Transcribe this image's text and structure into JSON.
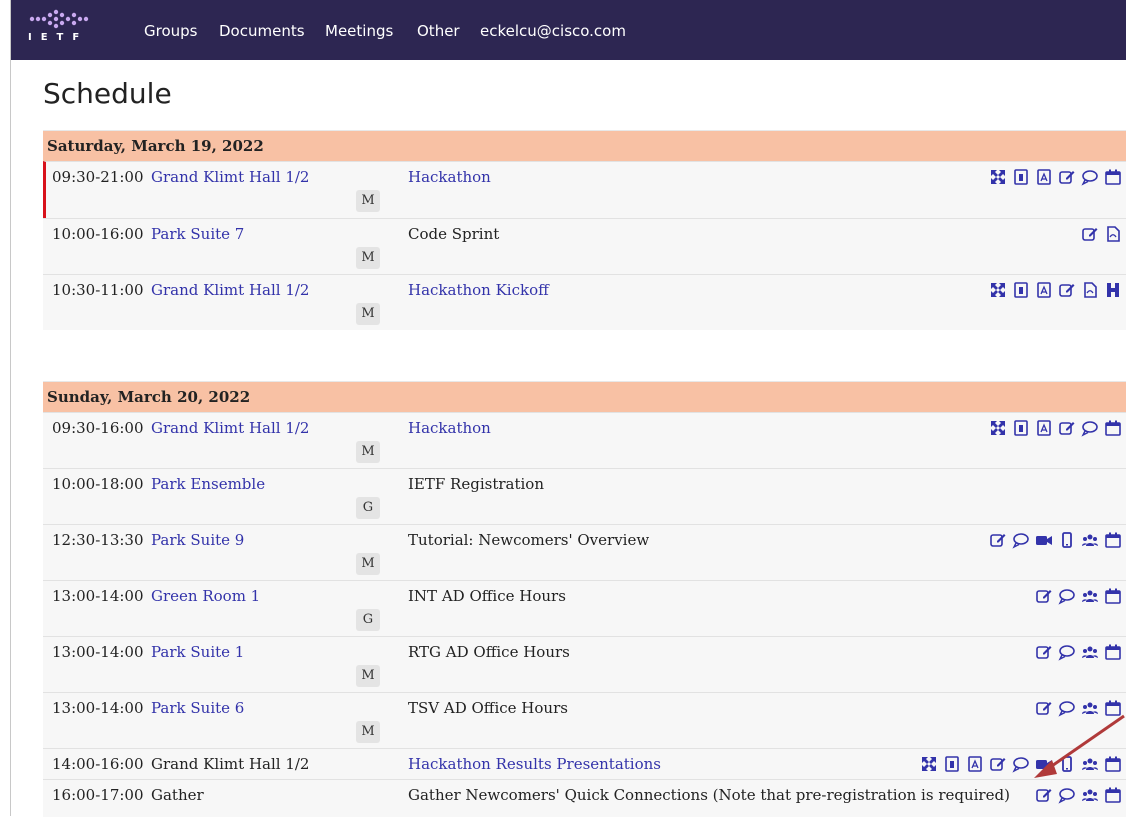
{
  "navbar": {
    "logo_text": "IETF",
    "items": [
      "Groups",
      "Documents",
      "Meetings",
      "Other",
      "eckelcu@cisco.com"
    ]
  },
  "page": {
    "title": "Schedule"
  },
  "days": [
    {
      "date": "Saturday, March 19, 2022",
      "sessions": [
        {
          "time": "09:30-21:00",
          "room": "Grand Klimt Hall 1/2",
          "badge": "M",
          "title": "Hackathon"
        },
        {
          "time": "10:00-16:00",
          "room": "Park Suite 7",
          "badge": "M",
          "title": "Code Sprint"
        },
        {
          "time": "10:30-11:00",
          "room": "Grand Klimt Hall 1/2",
          "badge": "M",
          "title": "Hackathon Kickoff"
        }
      ]
    },
    {
      "date": "Sunday, March 20, 2022",
      "sessions": [
        {
          "time": "09:30-16:00",
          "room": "Grand Klimt Hall 1/2",
          "badge": "M",
          "title": "Hackathon"
        },
        {
          "time": "10:00-18:00",
          "room": "Park Ensemble",
          "badge": "G",
          "title": "IETF Registration"
        },
        {
          "time": "12:30-13:30",
          "room": "Park Suite 9",
          "badge": "M",
          "title": "Tutorial: Newcomers' Overview"
        },
        {
          "time": "13:00-14:00",
          "room": "Green Room 1",
          "badge": "G",
          "title": "INT AD Office Hours"
        },
        {
          "time": "13:00-14:00",
          "room": "Park Suite 1",
          "badge": "M",
          "title": "RTG AD Office Hours"
        },
        {
          "time": "13:00-14:00",
          "room": "Park Suite 6",
          "badge": "M",
          "title": "TSV AD Office Hours"
        },
        {
          "time": "14:00-16:00",
          "room": "Grand Klimt Hall 1/2",
          "badge": "",
          "title": "Hackathon Results Presentations"
        },
        {
          "time": "16:00-17:00",
          "room": "Gather",
          "badge": "",
          "title": "Gather Newcomers' Quick Connections (Note that pre-registration is required)"
        }
      ]
    }
  ],
  "colors": {
    "navbar": "#2d2652",
    "day_header": "#f8c1a4",
    "link": "#3333aa",
    "current_marker": "#d8121b",
    "annotation_arrow": "#b03a3a"
  },
  "icon_legend": [
    "expand-icon",
    "materials-icon",
    "pdf-icon",
    "edit-notes-icon",
    "chat-icon",
    "video-icon",
    "mobile-icon",
    "people-icon",
    "calendar-icon",
    "document-icon",
    "h-icon"
  ]
}
